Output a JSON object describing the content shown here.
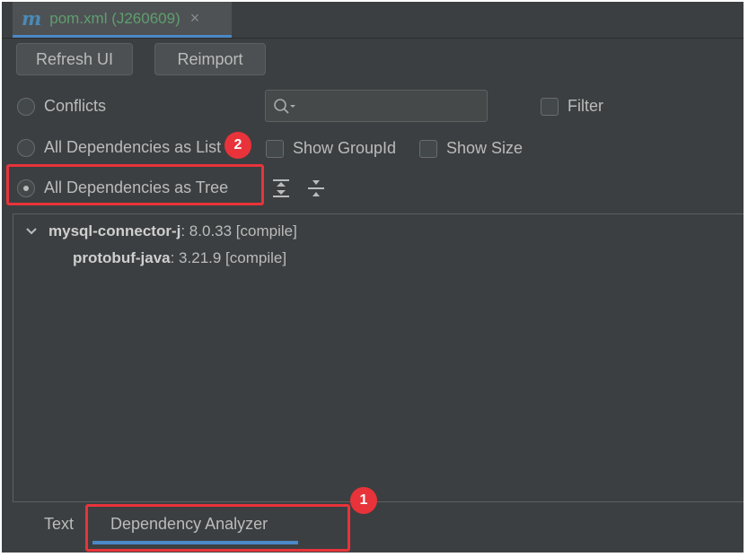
{
  "editor_tab": {
    "title": "pom.xml (J260609)",
    "close_glyph": "×",
    "icon": "maven-m-icon"
  },
  "toolbar": {
    "refresh_label": "Refresh UI",
    "reimport_label": "Reimport"
  },
  "view_options": {
    "conflicts_label": "Conflicts",
    "list_label": "All Dependencies as List",
    "tree_label": "All Dependencies as Tree",
    "selected": "tree"
  },
  "filter": {
    "filter_label": "Filter",
    "show_groupid_label": "Show GroupId",
    "show_size_label": "Show Size"
  },
  "tree": {
    "items": [
      {
        "artifact": "mysql-connector-j",
        "rest": " : 8.0.33 [compile]",
        "expanded": true
      },
      {
        "artifact": "protobuf-java",
        "rest": " : 3.21.9 [compile]"
      }
    ]
  },
  "bottom_tabs": {
    "text_label": "Text",
    "analyzer_label": "Dependency Analyzer",
    "active": "analyzer"
  },
  "annotations": {
    "badge1": "1",
    "badge2": "2",
    "color": "#e8333a"
  }
}
